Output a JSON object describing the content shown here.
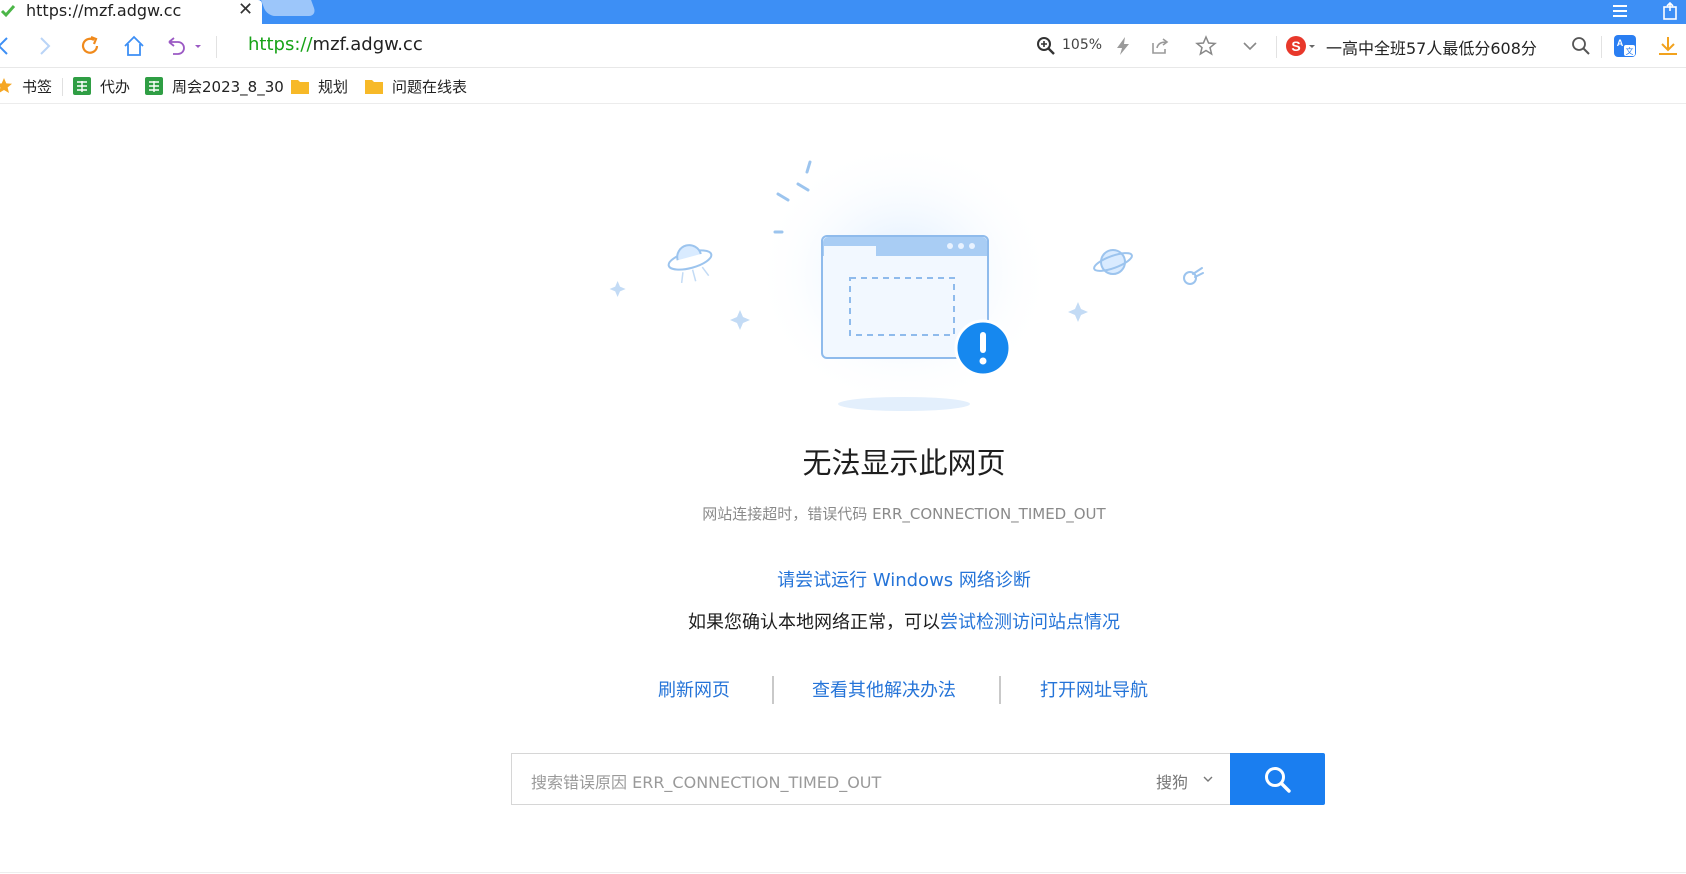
{
  "tab": {
    "title": "https://mzf.adgw.cc",
    "close": "✕"
  },
  "nav": {
    "url_scheme": "https://",
    "url_host": "mzf.adgw.cc",
    "zoom": "105%",
    "search_hint": "一高中全班57人最低分608分"
  },
  "bookmarks": [
    {
      "label": "书签",
      "icon": "star-icon"
    },
    {
      "label": "代办",
      "icon": "sheet-icon"
    },
    {
      "label": "周会2023_8_30",
      "icon": "sheet-icon"
    },
    {
      "label": "规划",
      "icon": "folder-icon"
    },
    {
      "label": "问题在线表",
      "icon": "folder-icon"
    }
  ],
  "error": {
    "title": "无法显示此网页",
    "subtitle": "网站连接超时，错误代码 ERR_CONNECTION_TIMED_OUT",
    "diag_link": "请尝试运行 Windows 网络诊断",
    "check_prefix": "如果您确认本地网络正常，可以",
    "check_link": "尝试检测访问站点情况"
  },
  "actions": {
    "refresh": "刷新网页",
    "other_solutions": "查看其他解决办法",
    "open_nav": "打开网址导航"
  },
  "search": {
    "placeholder": "搜索错误原因 ERR_CONNECTION_TIMED_OUT",
    "engine": "搜狗"
  },
  "colors": {
    "tabbar": "#3d8ff5",
    "link": "#2574d8",
    "search_button": "#1a7ef0",
    "url_scheme": "#17a317"
  }
}
